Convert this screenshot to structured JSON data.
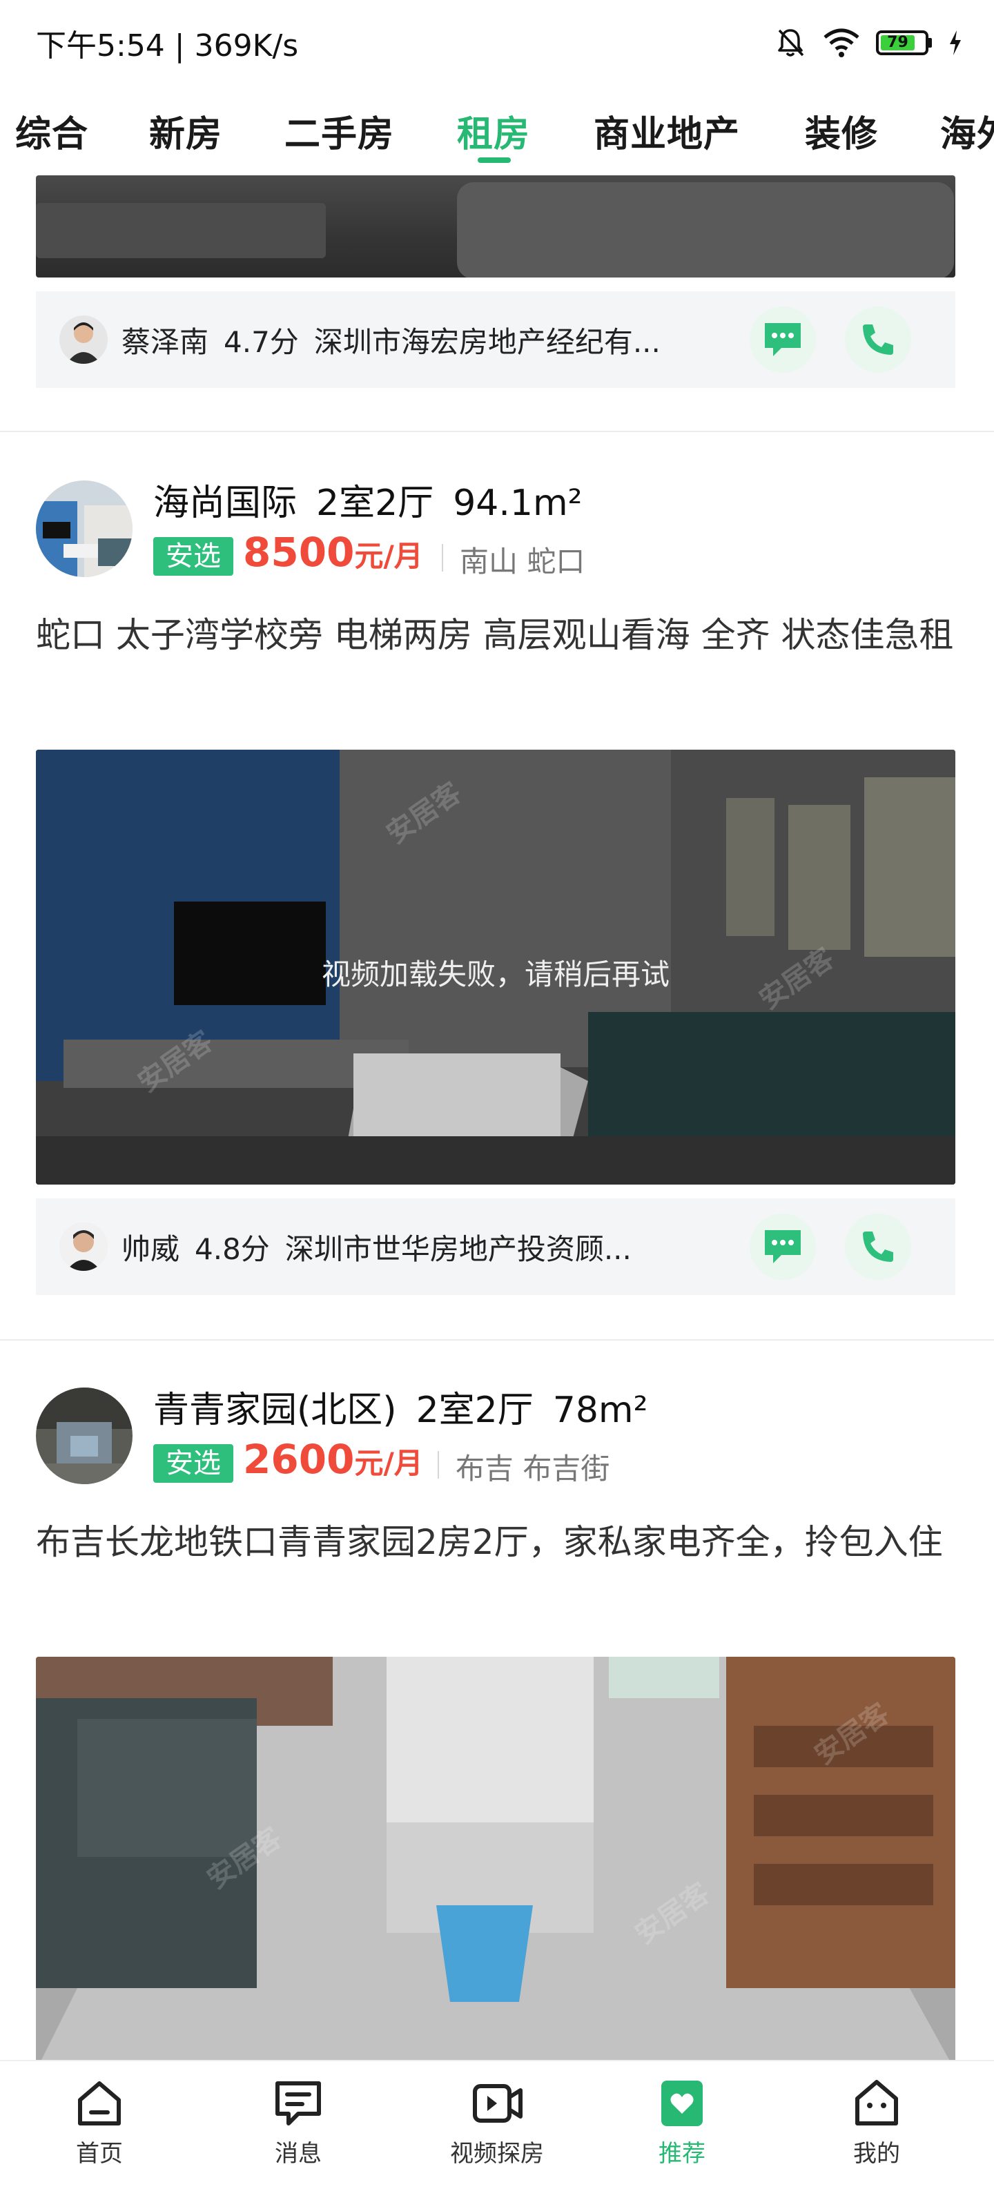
{
  "status_bar": {
    "time_speed": "下午5:54 | 369K/s",
    "battery_level": "79"
  },
  "top_tabs": {
    "items": [
      "综合",
      "新房",
      "二手房",
      "租房",
      "商业地产",
      "装修",
      "海外"
    ],
    "active": "租房"
  },
  "listings": [
    {
      "agent": {
        "name": "蔡泽南",
        "score": "4.7分",
        "company": "深圳市海宏房地产经纪有..."
      }
    },
    {
      "title": "海尚国际",
      "layout": "2室2厅",
      "area": "94.1m²",
      "badge": "安选",
      "price": "8500",
      "price_unit": "元/月",
      "location": "南山 蛇口",
      "description": "蛇口 太子湾学校旁 电梯两房 高层观山看海 全齐 状态佳急租",
      "video_message": "视频加载失败，请稍后再试",
      "agent": {
        "name": "帅威",
        "score": "4.8分",
        "company": "深圳市世华房地产投资顾..."
      }
    },
    {
      "title": "青青家园(北区)",
      "layout": "2室2厅",
      "area": "78m²",
      "badge": "安选",
      "price": "2600",
      "price_unit": "元/月",
      "location": "布吉 布吉街",
      "description": "布吉长龙地铁口青青家园2房2厅，家私家电齐全，拎包入住"
    }
  ],
  "watermark_text": "安居客",
  "bottom_nav": {
    "items": [
      {
        "label": "首页",
        "icon": "home-icon"
      },
      {
        "label": "消息",
        "icon": "message-icon"
      },
      {
        "label": "视频探房",
        "icon": "video-icon"
      },
      {
        "label": "推荐",
        "icon": "recommend-icon"
      },
      {
        "label": "我的",
        "icon": "profile-icon"
      }
    ],
    "active": "推荐"
  },
  "colors": {
    "accent": "#27b873",
    "price": "#f04a3a",
    "badge": "#2fbf7d"
  }
}
